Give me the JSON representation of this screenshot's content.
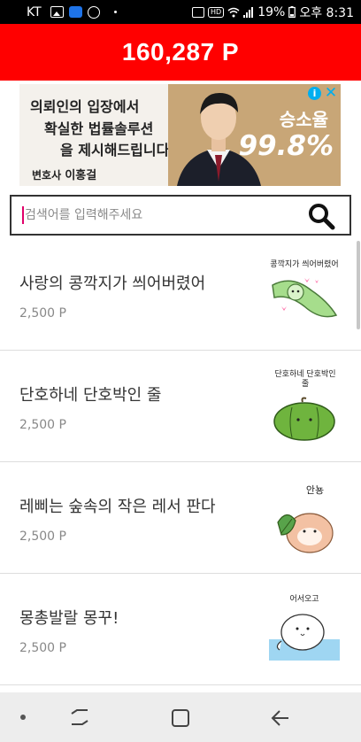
{
  "status_bar": {
    "carrier": "KT",
    "battery_percent": "19%",
    "time": "오후 8:31",
    "hd_badge": "HD"
  },
  "header": {
    "points": "160,287 P"
  },
  "ad": {
    "headline_line1": "의뢰인의 입장에서",
    "headline_line2": "확실한 법률솔루션",
    "headline_line3": "을 제시해드립니다!",
    "lawyer_prefix": "변호사",
    "lawyer_name": "이홍걸",
    "stat_label": "승소율",
    "stat_value": "99.8%",
    "info_glyph": "i",
    "close_glyph": "✕"
  },
  "search": {
    "placeholder": "검색어를 입력해주세요",
    "icon": "search-icon"
  },
  "items": [
    {
      "title": "사랑의 콩깍지가 씌어버렸어",
      "price": "2,500 P",
      "thumb_caption": "콩깍지가 씌어버렸어"
    },
    {
      "title": "단호하네 단호박인 줄",
      "price": "2,500 P",
      "thumb_caption": "단호하네 단호박인 줄"
    },
    {
      "title": "레삐는 숲속의 작은 레서 판다",
      "price": "2,500 P",
      "thumb_caption": "안뇽"
    },
    {
      "title": "몽총발랄 몽꾸!",
      "price": "2,500 P",
      "thumb_caption": "어서오고"
    }
  ],
  "nav": {
    "icons": [
      "recent-apps-icon",
      "home-icon",
      "back-icon"
    ]
  },
  "colors": {
    "header_bg": "#ff0000",
    "ad_bg": "#c8a677",
    "status_bg": "#000000"
  }
}
